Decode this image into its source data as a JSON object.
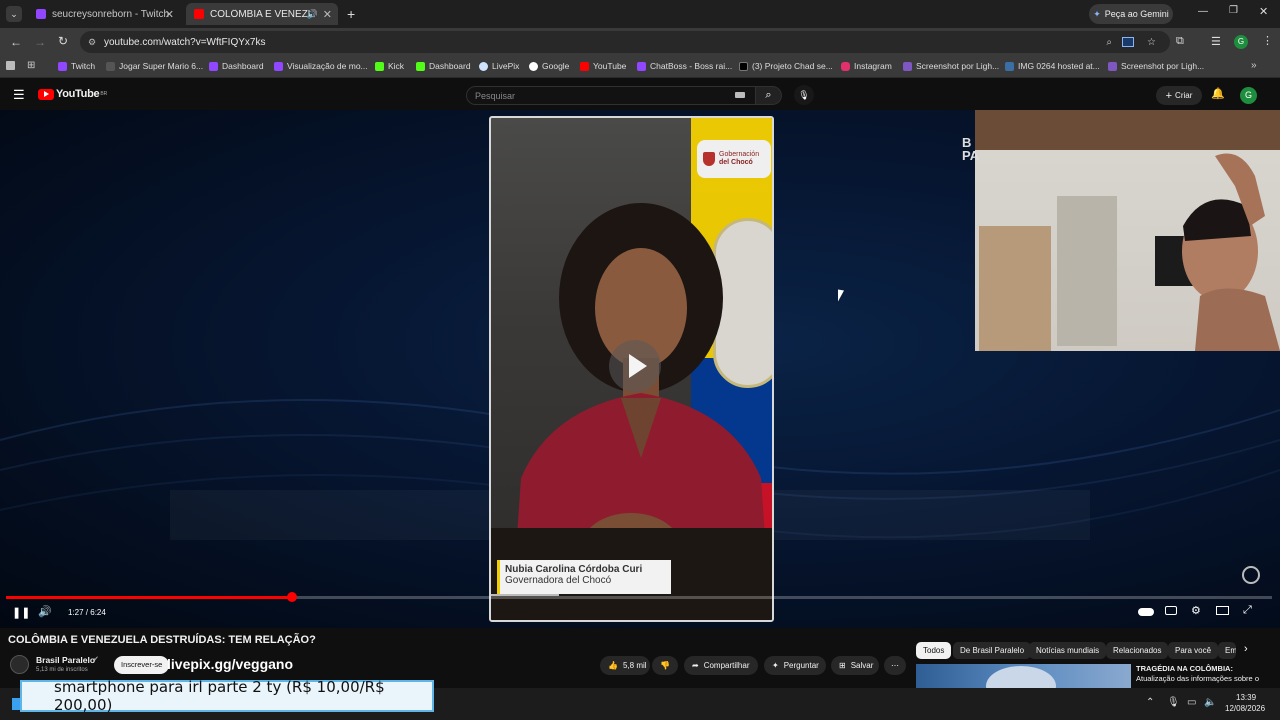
{
  "browser": {
    "tabs": [
      {
        "label": "seucreysonreborn - Twitch",
        "active": false
      },
      {
        "label": "COLÔMBIA E VENEZUELA D",
        "active": true
      }
    ],
    "gemini_label": "Peça ao Gemini",
    "url": "youtube.com/watch?v=WftFIQYx7ks",
    "profile_initial": "G"
  },
  "bookmarks": [
    "Twitch",
    "Jogar Super Mario 6...",
    "Dashboard",
    "Visualização de mo...",
    "Kick",
    "Dashboard",
    "LivePix",
    "Google",
    "YouTube",
    "ChatBoss - Boss rai...",
    "(3) Projeto Chad se...",
    "Instagram",
    "Screenshot por Ligh...",
    "IMG 0264 hosted at...",
    "Screenshot por Ligh..."
  ],
  "youtube": {
    "logo": "YouTube",
    "logo_sup": "BR",
    "search_placeholder": "Pesquisar",
    "create_label": "Criar",
    "avatar_initial": "G"
  },
  "video": {
    "lower_third_name": "Nubia Carolina Córdoba Curi",
    "lower_third_role": "Governadora del Chocó",
    "flag_text_1": "Gobernación",
    "flag_text_2": "del Chocó",
    "time": "1:27 / 6:24",
    "progress": 0.226,
    "title": "COLÔMBIA E VENEZUELA DESTRUÍDAS: TEM RELAÇÃO?",
    "corner_text": "B\nPA"
  },
  "channel": {
    "name": "Brasil Paralelo",
    "subs": "5,13 mi de inscritos",
    "subscribe_label": "Inscrever-se",
    "overlay_text": "livepix.gg/veggano"
  },
  "actions": {
    "likes": "5,8 mil",
    "share": "Compartilhar",
    "ask": "Perguntar",
    "save": "Salvar"
  },
  "chips": [
    "Todos",
    "De Brasil Paralelo",
    "Notícias mundiais",
    "Relacionados",
    "Para você",
    "Em"
  ],
  "related": {
    "title_1": "TRAGÉDIA NA COLÔMBIA:",
    "title_2": "Atualização das informações sobre o"
  },
  "donation_banner": "smartphone para irl parte 2 ty (R$ 10,00/R$ 200,00)",
  "taskbar": {
    "time": "13:39",
    "date": "12/08/2026"
  },
  "colors": {
    "accent_red": "#ff0000",
    "banner_border": "#5eb6e8"
  }
}
